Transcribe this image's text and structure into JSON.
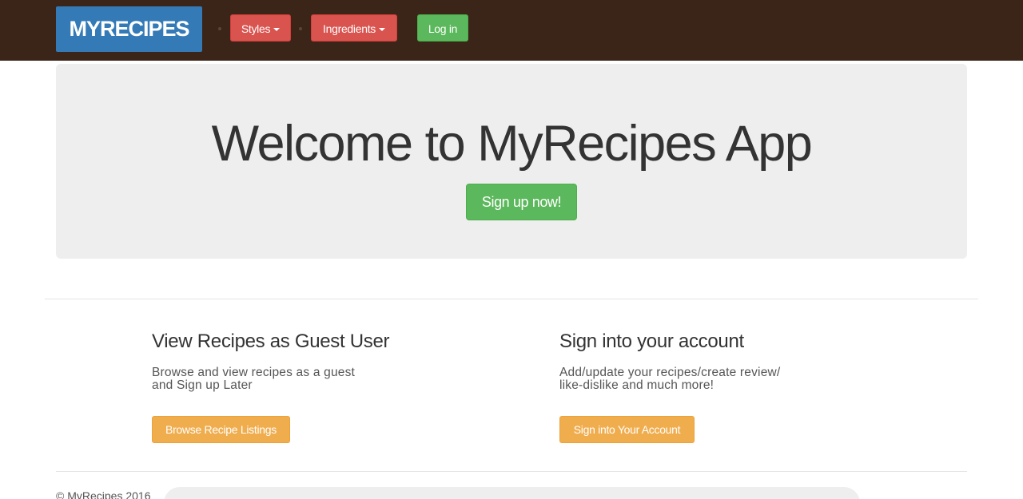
{
  "navbar": {
    "brand": "MYRECIPES",
    "styles_label": "Styles",
    "ingredients_label": "Ingredients",
    "login_label": "Log in"
  },
  "jumbotron": {
    "title": "Welcome to MyRecipes App",
    "signup_label": "Sign up now!"
  },
  "guest": {
    "heading": "View Recipes as Guest User",
    "text": "Browse and view recipes as a guest\nand Sign up Later",
    "button_label": "Browse Recipe Listings"
  },
  "account": {
    "heading": "Sign into your account",
    "text": "Add/update your recipes/create review/\nlike-dislike and much more!",
    "button_label": "Sign into Your Account"
  },
  "footer": {
    "copyright": "© MyRecipes 2016"
  },
  "colors": {
    "navbar_bg": "#3a2518",
    "brand_blue": "#337ab7",
    "danger_red": "#d9534f",
    "success_green": "#5cb85c",
    "warning_orange": "#f0ad4e",
    "jumbotron_bg": "#eeeeee"
  }
}
